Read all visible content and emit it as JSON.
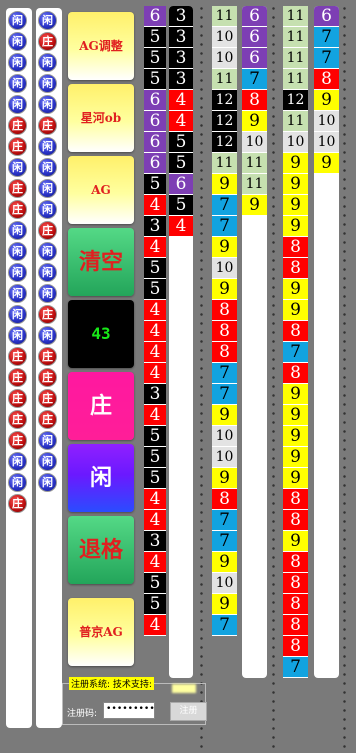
{
  "colors": {
    "purple": "#7d3fb4",
    "black": "#000000",
    "red": "#ff0000",
    "green": "#c6e0b0",
    "gray": "#e3e3e3",
    "blue": "#12a3e0",
    "yellow": "#ffff00",
    "background": "#7a7a7a"
  },
  "road1": [
    "闲",
    "闲",
    "闲",
    "闲",
    "闲",
    "庄",
    "庄",
    "闲",
    "庄",
    "庄",
    "闲",
    "闲",
    "闲",
    "闲",
    "闲",
    "闲",
    "庄",
    "庄",
    "庄",
    "庄",
    "庄",
    "闲",
    "闲",
    "庄"
  ],
  "road2": [
    "闲",
    "庄",
    "闲",
    "闲",
    "闲",
    "庄",
    "闲",
    "闲",
    "闲",
    "闲",
    "庄",
    "闲",
    "闲",
    "闲",
    "庄",
    "闲",
    "庄",
    "庄",
    "庄",
    "庄",
    "闲",
    "闲",
    "闲"
  ],
  "buttons": {
    "ag_adjust": "AG调整",
    "xinghe_ob": "星河ob",
    "ag": "AG",
    "clear": "清空",
    "count": "43",
    "zhuang": "庄",
    "xian": "闲",
    "undo": "退格",
    "pujing_ag": "普京AG"
  },
  "col_a": [
    {
      "v": "6",
      "c": "purple"
    },
    {
      "v": "5",
      "c": "black"
    },
    {
      "v": "5",
      "c": "black"
    },
    {
      "v": "5",
      "c": "black"
    },
    {
      "v": "6",
      "c": "purple"
    },
    {
      "v": "6",
      "c": "purple"
    },
    {
      "v": "6",
      "c": "purple"
    },
    {
      "v": "6",
      "c": "purple"
    },
    {
      "v": "5",
      "c": "black"
    },
    {
      "v": "4",
      "c": "red"
    },
    {
      "v": "3",
      "c": "black"
    },
    {
      "v": "4",
      "c": "red"
    },
    {
      "v": "5",
      "c": "black"
    },
    {
      "v": "5",
      "c": "black"
    },
    {
      "v": "4",
      "c": "red"
    },
    {
      "v": "4",
      "c": "red"
    },
    {
      "v": "4",
      "c": "red"
    },
    {
      "v": "4",
      "c": "red"
    },
    {
      "v": "3",
      "c": "black"
    },
    {
      "v": "4",
      "c": "red"
    },
    {
      "v": "5",
      "c": "black"
    },
    {
      "v": "5",
      "c": "black"
    },
    {
      "v": "5",
      "c": "black"
    },
    {
      "v": "4",
      "c": "red"
    },
    {
      "v": "4",
      "c": "red"
    },
    {
      "v": "3",
      "c": "black"
    },
    {
      "v": "4",
      "c": "red"
    },
    {
      "v": "5",
      "c": "black"
    },
    {
      "v": "5",
      "c": "black"
    },
    {
      "v": "4",
      "c": "red"
    }
  ],
  "col_b": [
    {
      "v": "3",
      "c": "black"
    },
    {
      "v": "3",
      "c": "black"
    },
    {
      "v": "3",
      "c": "black"
    },
    {
      "v": "3",
      "c": "black"
    },
    {
      "v": "4",
      "c": "red"
    },
    {
      "v": "4",
      "c": "red"
    },
    {
      "v": "5",
      "c": "black"
    },
    {
      "v": "5",
      "c": "black"
    },
    {
      "v": "6",
      "c": "purple"
    },
    {
      "v": "5",
      "c": "black"
    },
    {
      "v": "4",
      "c": "red"
    }
  ],
  "col_c": [
    {
      "v": "11",
      "c": "green"
    },
    {
      "v": "10",
      "c": "gray"
    },
    {
      "v": "10",
      "c": "gray"
    },
    {
      "v": "11",
      "c": "green"
    },
    {
      "v": "12",
      "c": "black"
    },
    {
      "v": "12",
      "c": "black"
    },
    {
      "v": "12",
      "c": "black"
    },
    {
      "v": "11",
      "c": "green"
    },
    {
      "v": "9",
      "c": "yellow"
    },
    {
      "v": "7",
      "c": "blue"
    },
    {
      "v": "7",
      "c": "blue"
    },
    {
      "v": "9",
      "c": "yellow"
    },
    {
      "v": "10",
      "c": "gray"
    },
    {
      "v": "9",
      "c": "yellow"
    },
    {
      "v": "8",
      "c": "red"
    },
    {
      "v": "8",
      "c": "red"
    },
    {
      "v": "8",
      "c": "red"
    },
    {
      "v": "7",
      "c": "blue"
    },
    {
      "v": "7",
      "c": "blue"
    },
    {
      "v": "9",
      "c": "yellow"
    },
    {
      "v": "10",
      "c": "gray"
    },
    {
      "v": "10",
      "c": "gray"
    },
    {
      "v": "9",
      "c": "yellow"
    },
    {
      "v": "8",
      "c": "red"
    },
    {
      "v": "7",
      "c": "blue"
    },
    {
      "v": "7",
      "c": "blue"
    },
    {
      "v": "9",
      "c": "yellow"
    },
    {
      "v": "10",
      "c": "gray"
    },
    {
      "v": "9",
      "c": "yellow"
    },
    {
      "v": "7",
      "c": "blue"
    }
  ],
  "col_d": [
    {
      "v": "6",
      "c": "purple"
    },
    {
      "v": "6",
      "c": "purple"
    },
    {
      "v": "6",
      "c": "purple"
    },
    {
      "v": "7",
      "c": "blue"
    },
    {
      "v": "8",
      "c": "red"
    },
    {
      "v": "9",
      "c": "yellow"
    },
    {
      "v": "10",
      "c": "gray"
    },
    {
      "v": "11",
      "c": "green"
    },
    {
      "v": "11",
      "c": "green"
    },
    {
      "v": "9",
      "c": "yellow"
    }
  ],
  "col_e": [
    {
      "v": "11",
      "c": "green"
    },
    {
      "v": "11",
      "c": "green"
    },
    {
      "v": "11",
      "c": "green"
    },
    {
      "v": "11",
      "c": "green"
    },
    {
      "v": "12",
      "c": "black"
    },
    {
      "v": "11",
      "c": "green"
    },
    {
      "v": "10",
      "c": "gray"
    },
    {
      "v": "9",
      "c": "yellow"
    },
    {
      "v": "9",
      "c": "yellow"
    },
    {
      "v": "9",
      "c": "yellow"
    },
    {
      "v": "9",
      "c": "yellow"
    },
    {
      "v": "8",
      "c": "red"
    },
    {
      "v": "8",
      "c": "red"
    },
    {
      "v": "9",
      "c": "yellow"
    },
    {
      "v": "9",
      "c": "yellow"
    },
    {
      "v": "8",
      "c": "red"
    },
    {
      "v": "7",
      "c": "blue"
    },
    {
      "v": "8",
      "c": "red"
    },
    {
      "v": "9",
      "c": "yellow"
    },
    {
      "v": "9",
      "c": "yellow"
    },
    {
      "v": "9",
      "c": "yellow"
    },
    {
      "v": "9",
      "c": "yellow"
    },
    {
      "v": "9",
      "c": "yellow"
    },
    {
      "v": "8",
      "c": "red"
    },
    {
      "v": "8",
      "c": "red"
    },
    {
      "v": "9",
      "c": "yellow"
    },
    {
      "v": "8",
      "c": "red"
    },
    {
      "v": "8",
      "c": "red"
    },
    {
      "v": "8",
      "c": "red"
    },
    {
      "v": "8",
      "c": "red"
    },
    {
      "v": "8",
      "c": "red"
    },
    {
      "v": "7",
      "c": "blue"
    }
  ],
  "col_f": [
    {
      "v": "6",
      "c": "purple"
    },
    {
      "v": "7",
      "c": "blue"
    },
    {
      "v": "7",
      "c": "blue"
    },
    {
      "v": "8",
      "c": "red"
    },
    {
      "v": "9",
      "c": "yellow"
    },
    {
      "v": "10",
      "c": "gray"
    },
    {
      "v": "10",
      "c": "gray"
    },
    {
      "v": "9",
      "c": "yellow"
    }
  ],
  "register": {
    "title": "注册系统: 技术支持:",
    "code_label": "注册码:",
    "code_value": "••••••••••••••••",
    "submit_label": "注册"
  }
}
